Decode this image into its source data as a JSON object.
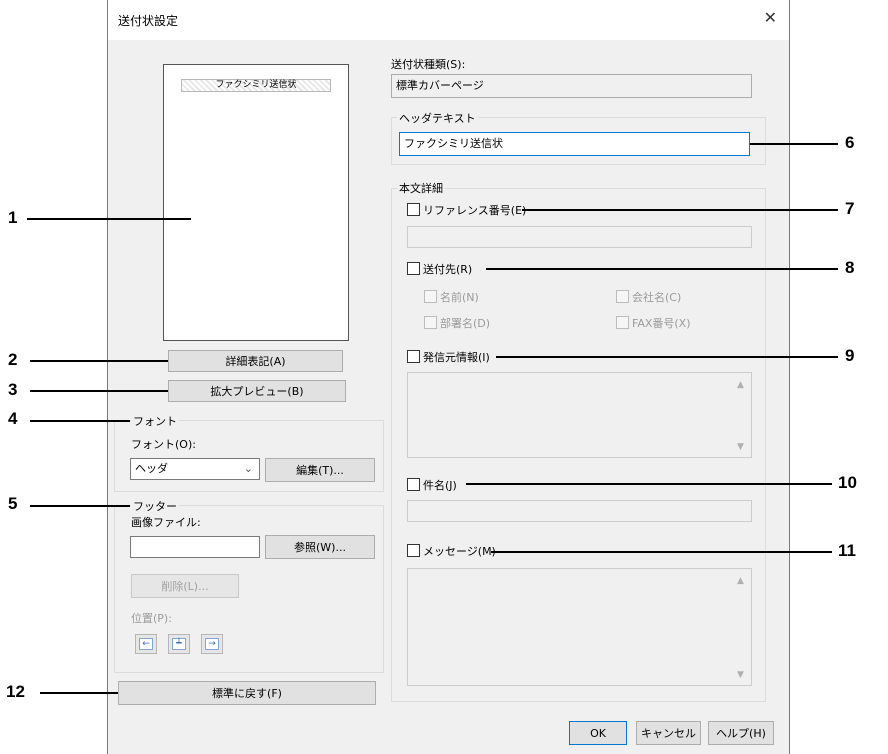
{
  "window": {
    "title": "送付状設定",
    "close_glyph": "✕"
  },
  "preview": {
    "header_text": "ファクシミリ送信状"
  },
  "buttons": {
    "details": "詳細表記(A)",
    "enlarge": "拡大プレビュー(B)",
    "edit_font": "編集(T)...",
    "browse": "参照(W)...",
    "delete": "削除(L)...",
    "reset": "標準に戻す(F)",
    "ok": "OK",
    "cancel": "キャンセル",
    "help": "ヘルプ(H)"
  },
  "font_group": {
    "legend": "フォント",
    "label": "フォント(O):",
    "selected": "ヘッダ"
  },
  "footer_group": {
    "legend": "フッター",
    "image_label": "画像ファイル:",
    "image_value": "",
    "position_label": "位置(P):"
  },
  "cover_type": {
    "label": "送付状種類(S):",
    "value": "標準カバーページ"
  },
  "header_text_group": {
    "legend": "ヘッダテキスト",
    "value": "ファクシミリ送信状"
  },
  "body_group": {
    "legend": "本文詳細",
    "reference": {
      "label": "リファレンス番号(E)",
      "checked": false,
      "value": ""
    },
    "recipient": {
      "label": "送付先(R)",
      "checked": false,
      "options": {
        "name": "名前(N)",
        "company": "会社名(C)",
        "department": "部署名(D)",
        "fax": "FAX番号(X)"
      }
    },
    "sender": {
      "label": "発信元情報(I)",
      "checked": false,
      "value": ""
    },
    "subject": {
      "label": "件名(J)",
      "checked": false,
      "value": ""
    },
    "message": {
      "label": "メッセージ(M)",
      "checked": false,
      "value": ""
    }
  },
  "callouts": [
    "1",
    "2",
    "3",
    "4",
    "5",
    "6",
    "7",
    "8",
    "9",
    "10",
    "11",
    "12"
  ],
  "colors": {
    "focus": "#0078d7",
    "dialog_bg": "#f0f0f0"
  }
}
